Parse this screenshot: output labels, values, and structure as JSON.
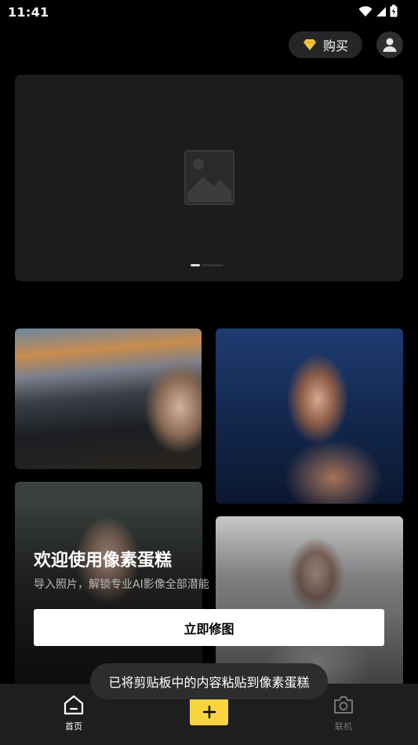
{
  "status_bar": {
    "time": "11:41"
  },
  "header": {
    "buy_label": "购买"
  },
  "banner": {
    "page_count": 2,
    "active_page": 1
  },
  "welcome": {
    "title": "欢迎使用像素蛋糕",
    "subtitle": "导入照片，解锁专业AI影像全部潜能",
    "cta_label": "立即修图"
  },
  "toast": {
    "text": "已将剪贴板中的内容粘贴到像素蛋糕"
  },
  "bottom_nav": {
    "home_label": "首页",
    "add_icon": "plus-icon",
    "connect_label": "联机"
  },
  "colors": {
    "accent": "#f8d440",
    "background": "#000000",
    "nav_bg": "#1e1e1e"
  }
}
